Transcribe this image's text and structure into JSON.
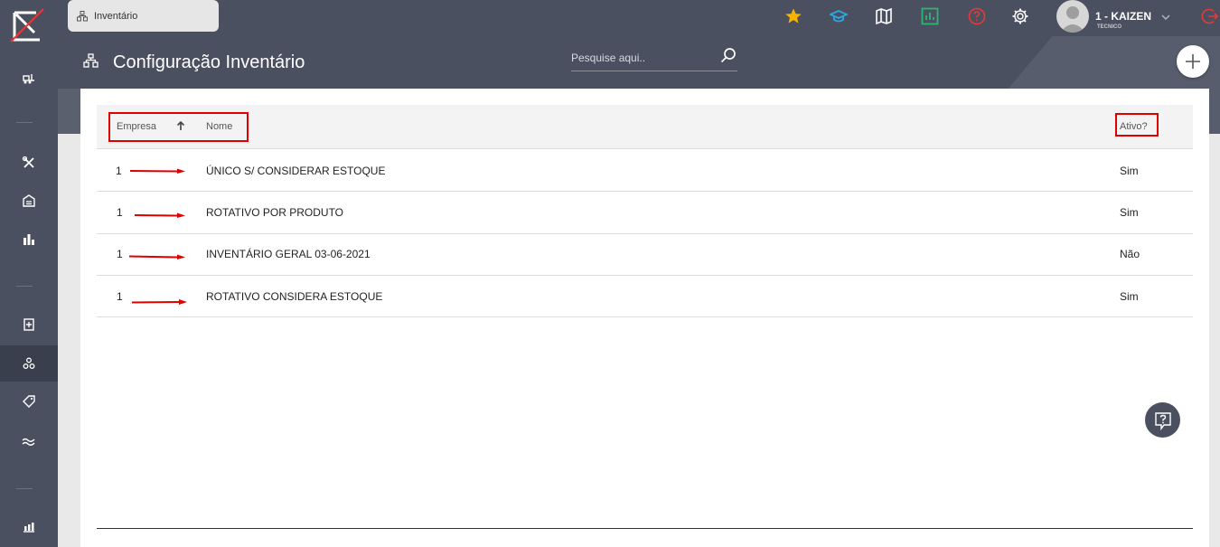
{
  "app": {
    "tab_label": "Inventário"
  },
  "colors": {
    "sidebar": "#4a5060",
    "star": "#f6b400",
    "academy": "#29a9e1",
    "chart": "#2bb673",
    "help": "#e53935",
    "logout": "#e53935",
    "highlight": "#e00000"
  },
  "user": {
    "name": "1 - KAIZEN",
    "role": "TECNICO"
  },
  "page": {
    "title": "Configuração Inventário"
  },
  "search": {
    "placeholder": "Pesquise aqui.."
  },
  "table": {
    "columns": {
      "empresa": "Empresa",
      "nome": "Nome",
      "ativo": "Ativo?"
    },
    "rows": [
      {
        "empresa": "1",
        "nome": "ÚNICO S/ CONSIDERAR ESTOQUE",
        "ativo": "Sim"
      },
      {
        "empresa": "1",
        "nome": "ROTATIVO POR PRODUTO",
        "ativo": "Sim"
      },
      {
        "empresa": "1",
        "nome": "INVENTÁRIO GERAL 03-06-2021",
        "ativo": "Não"
      },
      {
        "empresa": "1",
        "nome": "ROTATIVO CONSIDERA ESTOQUE",
        "ativo": "Sim"
      }
    ]
  },
  "icons": {
    "sidebar": [
      "forklift-icon",
      "tools-icon",
      "warehouse-icon",
      "bar-chart-icon",
      "document-add-icon",
      "inventory-icon",
      "tag-icon",
      "flow-icon",
      "report-chart-icon"
    ],
    "topbar": [
      "star-icon",
      "graduation-cap-icon",
      "map-icon",
      "chart-icon",
      "help-icon",
      "gear-icon",
      "chevron-down-icon",
      "logout-icon"
    ]
  }
}
